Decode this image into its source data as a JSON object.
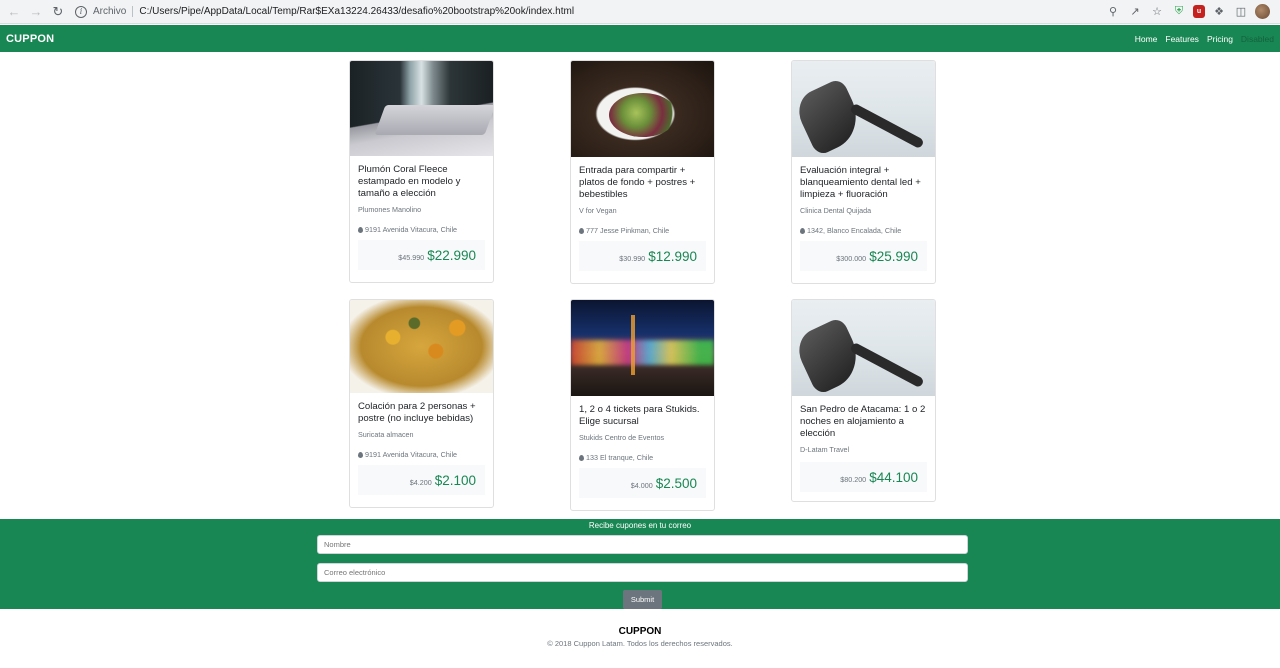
{
  "browser": {
    "scheme_label": "Archivo",
    "url": "C:/Users/Pipe/AppData/Local/Temp/Rar$EXa13224.26433/desafio%20bootstrap%20ok/index.html",
    "icons": [
      "back-arrow-icon",
      "forward-arrow-icon",
      "reload-icon",
      "info-icon",
      "zoom-icon",
      "share-icon",
      "star-icon",
      "shield-extension-icon",
      "ublock-extension-icon",
      "puzzle-extensions-icon",
      "side-panel-icon",
      "profile-avatar"
    ]
  },
  "navbar": {
    "brand": "CUPPON",
    "links": [
      {
        "label": "Home"
      },
      {
        "label": "Features"
      },
      {
        "label": "Pricing"
      },
      {
        "label": "Disabled"
      }
    ],
    "color": "#198754"
  },
  "cards": [
    {
      "title": "Plumón Coral Fleece estampado en modelo y tamaño a elección",
      "store": "Plumones Manolino",
      "address": "9191 Avenida Vitacura, Chile",
      "old_price": "$45.990",
      "price": "$22.990"
    },
    {
      "title": "Entrada para compartir + platos de fondo + postres + bebestibles",
      "store": "V for Vegan",
      "address": "777 Jesse Pinkman, Chile",
      "old_price": "$30.990",
      "price": "$12.990"
    },
    {
      "title": "Evaluación integral + blanqueamiento dental led + limpieza + fluoración",
      "store": "Clinica Dental Quijada",
      "address": "1342, Blanco Encalada, Chile",
      "old_price": "$300.000",
      "price": "$25.990"
    },
    {
      "title": "Colación para 2 personas + postre (no incluye bebidas)",
      "store": "Suricata almacen",
      "address": "9191 Avenida Vitacura, Chile",
      "old_price": "$4.200",
      "price": "$2.100"
    },
    {
      "title": "1, 2 o 4 tickets para Stukids. Elige sucursal",
      "store": "Stukids Centro de Eventos",
      "address": "133 El tranque, Chile",
      "old_price": "$4.000",
      "price": "$2.500"
    },
    {
      "title": "San Pedro de Atacama: 1 o 2 noches en alojamiento a elección",
      "store": "D-Latam Travel",
      "old_price": "$80.200",
      "price": "$44.100"
    }
  ],
  "subscribe": {
    "heading": "Recibe cupones en tu correo",
    "name_placeholder": "Nombre",
    "email_placeholder": "Correo electrónico",
    "submit_label": "Submit"
  },
  "footer": {
    "brand": "CUPPON",
    "copyright": "© 2018 Cuppon Latam. Todos los derechos reservados."
  }
}
